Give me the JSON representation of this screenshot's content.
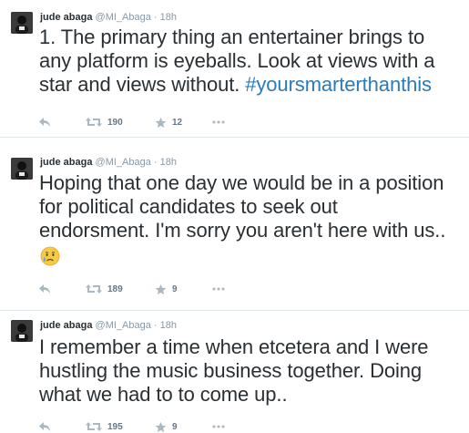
{
  "tweets": [
    {
      "name": "jude abaga",
      "handle": "@MI_Abaga",
      "separator": "·",
      "time": "18h",
      "text_lines": [
        "1. The primary thing an entertainer brings to",
        "any platform is eyeballs. Look at views with a",
        "star and views without."
      ],
      "hashtag": "#yoursmarterthanthis",
      "retweets": "190",
      "favorites": "12"
    },
    {
      "name": "jude abaga",
      "handle": "@MI_Abaga",
      "separator": "·",
      "time": "18h",
      "text_lines": [
        "Hoping that one day we would be in a position",
        "for political candidates to seek out",
        "endorsment. I'm sorry you aren't here with us.."
      ],
      "emoji": "crying-face-emoji",
      "retweets": "189",
      "favorites": "9"
    },
    {
      "name": "jude abaga",
      "handle": "@MI_Abaga",
      "separator": "·",
      "time": "18h",
      "text_lines": [
        "I remember a time when etcetera and I were",
        "hustling the music business together. Doing",
        "what we had to to come up.."
      ],
      "retweets": "195",
      "favorites": "9"
    }
  ],
  "colors": {
    "text": "#292f33",
    "muted": "#8899a6",
    "hashtag": "#2b7bb9",
    "divider": "#e1e8ed",
    "icon": "#aab8c2"
  }
}
